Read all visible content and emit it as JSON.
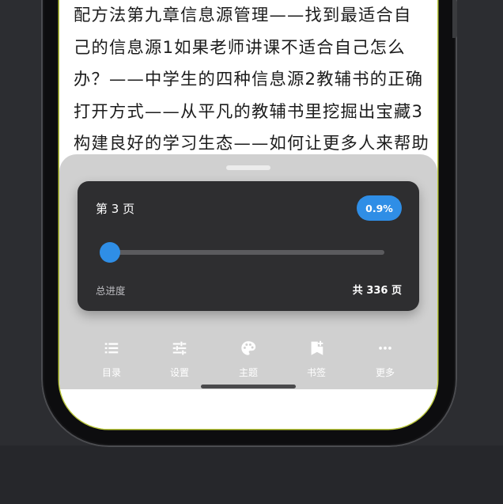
{
  "reader": {
    "lines": [
      "配方法第九章信息源管理——找到最适合自",
      "己的信息源1如果老师讲课不适合自己怎么",
      "办？——中学生的四种信息源2教辅书的正确",
      "打开方式——从平凡的教辅书里挖掘出宝藏3",
      "构建良好的学习生态——如何让更多人来帮助"
    ]
  },
  "progress_panel": {
    "page_label": "第 3 页",
    "percent_label": "0.9%",
    "progress_fraction": 0.009,
    "progress_caption": "总进度",
    "total_label": "共 336 页"
  },
  "toolbar": {
    "items": [
      {
        "label": "目录",
        "icon": "list-icon"
      },
      {
        "label": "设置",
        "icon": "sliders-icon"
      },
      {
        "label": "主题",
        "icon": "palette-icon"
      },
      {
        "label": "书签",
        "icon": "bookmark-add-icon"
      },
      {
        "label": "更多",
        "icon": "more-icon"
      }
    ]
  },
  "colors": {
    "accent": "#2f8ee6",
    "card_background": "#2e2e30",
    "sheet_background": "#d0d0d0",
    "page_background": "#ffffff"
  }
}
